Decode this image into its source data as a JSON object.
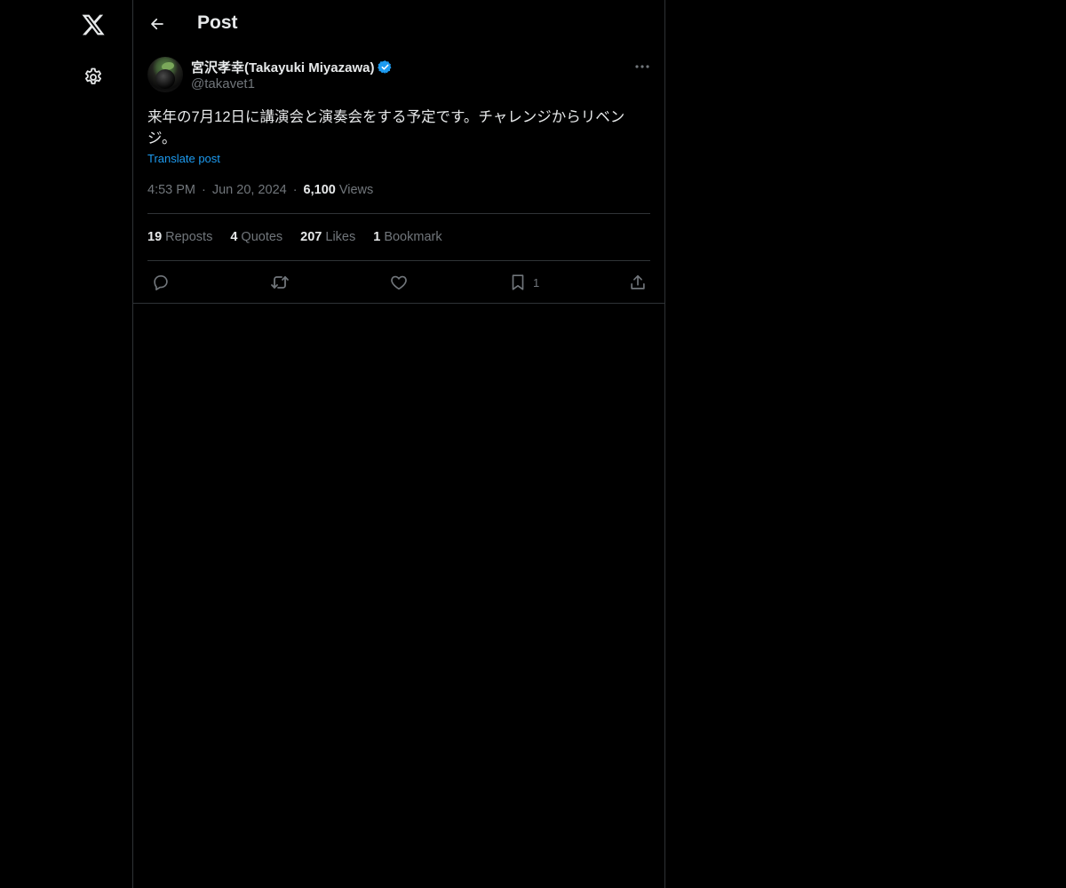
{
  "nav": {
    "logo_icon": "x-logo-icon",
    "settings_icon": "gear-icon"
  },
  "header": {
    "back_icon": "arrow-left-icon",
    "title": "Post"
  },
  "post": {
    "author": {
      "display_name": "宮沢孝幸(Takayuki Miyazawa)",
      "handle": "@takavet1",
      "verified": true,
      "verified_color": "#1d9bf0"
    },
    "text": "来年の7月12日に講演会と演奏会をする予定です。チャレンジからリベンジ。",
    "translate_label": "Translate post",
    "time": "4:53 PM",
    "separator": "·",
    "date": "Jun 20, 2024",
    "views_count": "6,100",
    "views_label": "Views",
    "stats": {
      "reposts_count": "19",
      "reposts_label": "Reposts",
      "quotes_count": "4",
      "quotes_label": "Quotes",
      "likes_count": "207",
      "likes_label": "Likes",
      "bookmarks_count": "1",
      "bookmarks_label": "Bookmark"
    },
    "actions": {
      "reply_icon": "reply-icon",
      "repost_icon": "repost-icon",
      "like_icon": "heart-icon",
      "bookmark_icon": "bookmark-icon",
      "bookmark_count": "1",
      "share_icon": "share-icon"
    }
  },
  "colors": {
    "background": "#000000",
    "text_primary": "#e7e9ea",
    "text_secondary": "#71767b",
    "accent": "#1d9bf0",
    "border": "#2f3336"
  }
}
